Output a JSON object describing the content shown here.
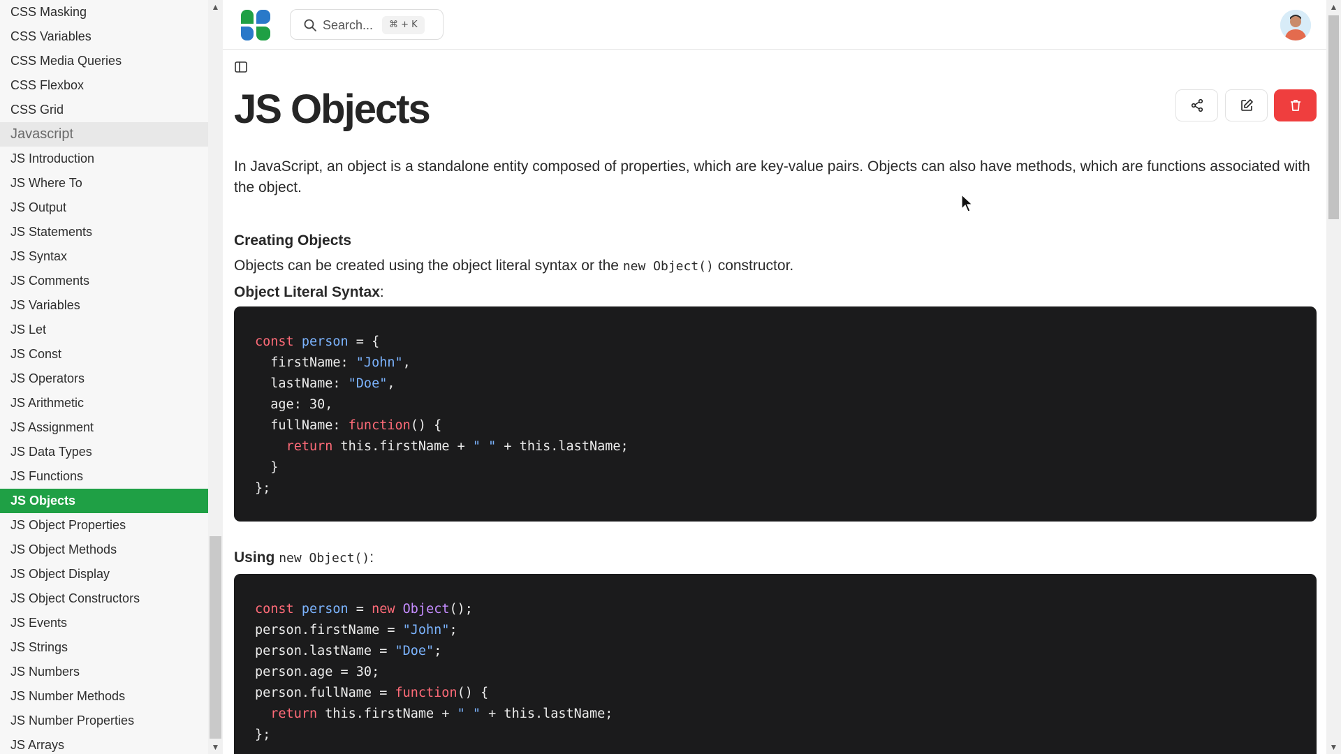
{
  "sidebar": {
    "items": [
      {
        "label": "CSS Masking"
      },
      {
        "label": "CSS Variables"
      },
      {
        "label": "CSS Media Queries"
      },
      {
        "label": "CSS Flexbox"
      },
      {
        "label": "CSS Grid"
      },
      {
        "label": "Javascript",
        "section": true
      },
      {
        "label": "JS Introduction"
      },
      {
        "label": "JS Where To"
      },
      {
        "label": "JS Output"
      },
      {
        "label": "JS Statements"
      },
      {
        "label": "JS Syntax"
      },
      {
        "label": "JS Comments"
      },
      {
        "label": "JS Variables"
      },
      {
        "label": "JS Let"
      },
      {
        "label": "JS Const"
      },
      {
        "label": "JS Operators"
      },
      {
        "label": "JS Arithmetic"
      },
      {
        "label": "JS Assignment"
      },
      {
        "label": "JS Data Types"
      },
      {
        "label": "JS Functions"
      },
      {
        "label": "JS Objects",
        "active": true
      },
      {
        "label": "JS Object Properties"
      },
      {
        "label": "JS Object Methods"
      },
      {
        "label": "JS Object Display"
      },
      {
        "label": "JS Object Constructors"
      },
      {
        "label": "JS Events"
      },
      {
        "label": "JS Strings"
      },
      {
        "label": "JS Numbers"
      },
      {
        "label": "JS Number Methods"
      },
      {
        "label": "JS Number Properties"
      },
      {
        "label": "JS Arrays"
      }
    ]
  },
  "header": {
    "search_placeholder": "Search...",
    "search_shortcut": "⌘ + K",
    "logo_icon": "clover-logo-icon",
    "avatar_icon": "user-avatar"
  },
  "page": {
    "title": "JS Objects",
    "intro": "In JavaScript, an object is a standalone entity composed of properties, which are key-value pairs. Objects can also have methods, which are functions associated with the object.",
    "section1_heading": "Creating Objects",
    "section1_text_before": "Objects can be created using the object literal syntax or the ",
    "section1_code_inline": "new Object()",
    "section1_text_after": " constructor.",
    "literal_heading": "Object Literal Syntax",
    "literal_colon": ":",
    "using_heading": "Using",
    "using_code_inline": "new Object()",
    "using_colon": ":"
  },
  "actions": {
    "share_icon": "share-icon",
    "edit_icon": "edit-icon",
    "delete_icon": "trash-icon",
    "delete_color": "#ef3e3e"
  },
  "code_blocks": {
    "literal": [
      "const person = {",
      "  firstName: \"John\",",
      "  lastName: \"Doe\",",
      "  age: 30,",
      "  fullName: function() {",
      "    return this.firstName + \" \" + this.lastName;",
      "  }",
      "};"
    ],
    "constructor": [
      "const person = new Object();",
      "person.firstName = \"John\";",
      "person.lastName = \"Doe\";",
      "person.age = 30;",
      "person.fullName = function() {",
      "  return this.firstName + \" \" + this.lastName;",
      "};"
    ]
  },
  "colors": {
    "accent": "#1fa045",
    "code_bg": "#1b1b1c",
    "keyword": "#ff6b78",
    "identifier": "#7cb4ff"
  }
}
